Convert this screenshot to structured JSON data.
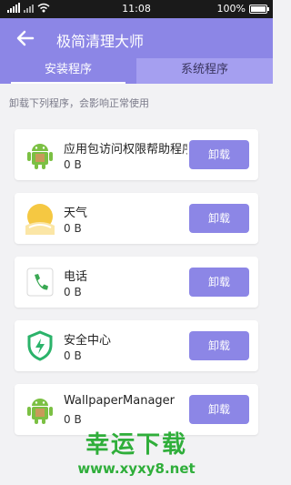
{
  "status_bar": {
    "time": "11:08",
    "battery": "100%"
  },
  "app_bar": {
    "title": "极简清理大师",
    "back_icon": "back-arrow-icon"
  },
  "tabs": [
    {
      "label": "安装程序",
      "active": true
    },
    {
      "label": "系统程序",
      "active": false
    }
  ],
  "notice": "卸载下列程序，会影响正常使用",
  "apps": [
    {
      "name": "应用包访问权限帮助程序",
      "size": "0 B",
      "button": "卸载",
      "icon": "android-icon"
    },
    {
      "name": "天气",
      "size": "0 B",
      "button": "卸载",
      "icon": "weather-sun-icon"
    },
    {
      "name": "电话",
      "size": "0 B",
      "button": "卸载",
      "icon": "phone-icon"
    },
    {
      "name": "安全中心",
      "size": "0 B",
      "button": "卸载",
      "icon": "shield-icon"
    },
    {
      "name": "WallpaperManager",
      "size": "0 B",
      "button": "卸载",
      "icon": "android-icon"
    }
  ],
  "watermark": {
    "title": "幸运下载",
    "url": "www.xyxy8.net"
  },
  "colors": {
    "accent": "#8c86e6",
    "tab_inactive": "#a59ff0",
    "watermark": "#2fae3a",
    "background": "#f2f2f4"
  }
}
